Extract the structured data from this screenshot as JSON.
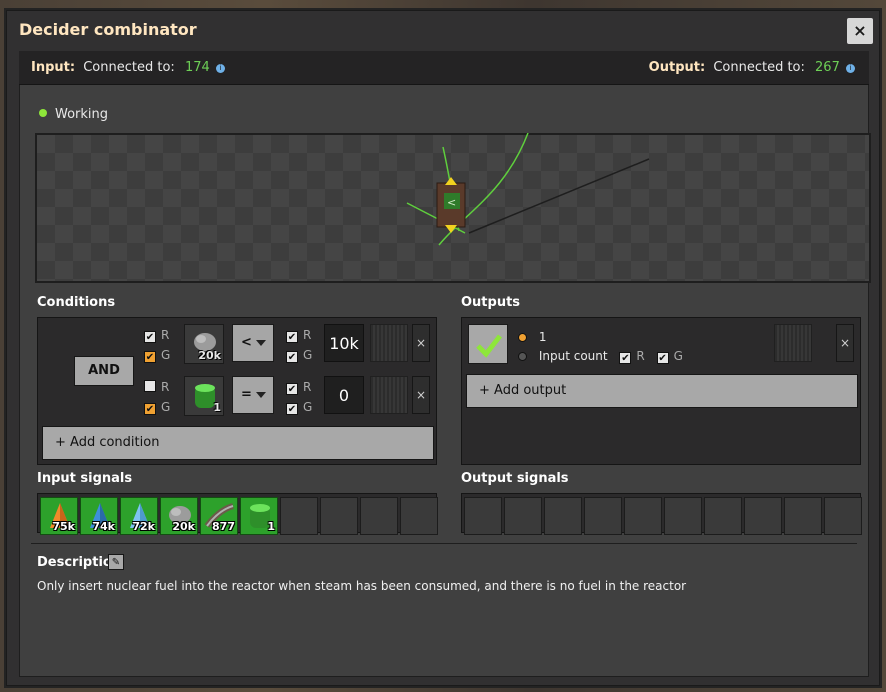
{
  "window": {
    "title": "Decider combinator",
    "close_label": "×"
  },
  "connections": {
    "input_label": "Input:",
    "input_text": "Connected to:",
    "input_count": "174",
    "output_label": "Output:",
    "output_text": "Connected to:",
    "output_count": "267"
  },
  "status": {
    "text": "Working"
  },
  "sections": {
    "conditions": "Conditions",
    "outputs": "Outputs",
    "input_signals": "Input signals",
    "output_signals": "Output signals",
    "description": "Description"
  },
  "conditions": {
    "logic": "AND",
    "rows": [
      {
        "r": "R",
        "g": "G",
        "r_checked": true,
        "g_checked": true,
        "signal_icon": "stone-icon",
        "signal_count": "20k",
        "comparator": "<",
        "rr": "R",
        "rg": "G",
        "rr_checked": true,
        "rg_checked": true,
        "value": "10k",
        "remove": "×"
      },
      {
        "r": "R",
        "g": "G",
        "r_checked": false,
        "g_checked": true,
        "signal_icon": "nuclear-fuel-icon",
        "signal_count": "1",
        "comparator": "=",
        "rr": "R",
        "rg": "G",
        "rr_checked": true,
        "rg_checked": true,
        "value": "0",
        "remove": "×"
      }
    ],
    "add_label": "+ Add condition"
  },
  "outputs": {
    "value": "1",
    "input_count_label": "Input count",
    "r": "R",
    "g": "G",
    "remove": "×",
    "add_label": "+ Add output"
  },
  "input_signals": [
    {
      "icon": "cone-orange-icon",
      "count": "75k"
    },
    {
      "icon": "cone-blue-icon",
      "count": "74k"
    },
    {
      "icon": "cone-lightblue-icon",
      "count": "72k"
    },
    {
      "icon": "stone-icon",
      "count": "20k"
    },
    {
      "icon": "rail-icon",
      "count": "877"
    },
    {
      "icon": "nuclear-fuel-icon",
      "count": "1"
    }
  ],
  "description": {
    "edit_icon": "pencil-icon",
    "text": "Only insert nuclear fuel into the reactor when steam has been consumed, and there is no fuel in the reactor"
  },
  "colors": {
    "accent": "#ffe6c0",
    "connected": "#6dcf56",
    "signal_bg": "#2da12b",
    "working": "#8ee63a"
  }
}
